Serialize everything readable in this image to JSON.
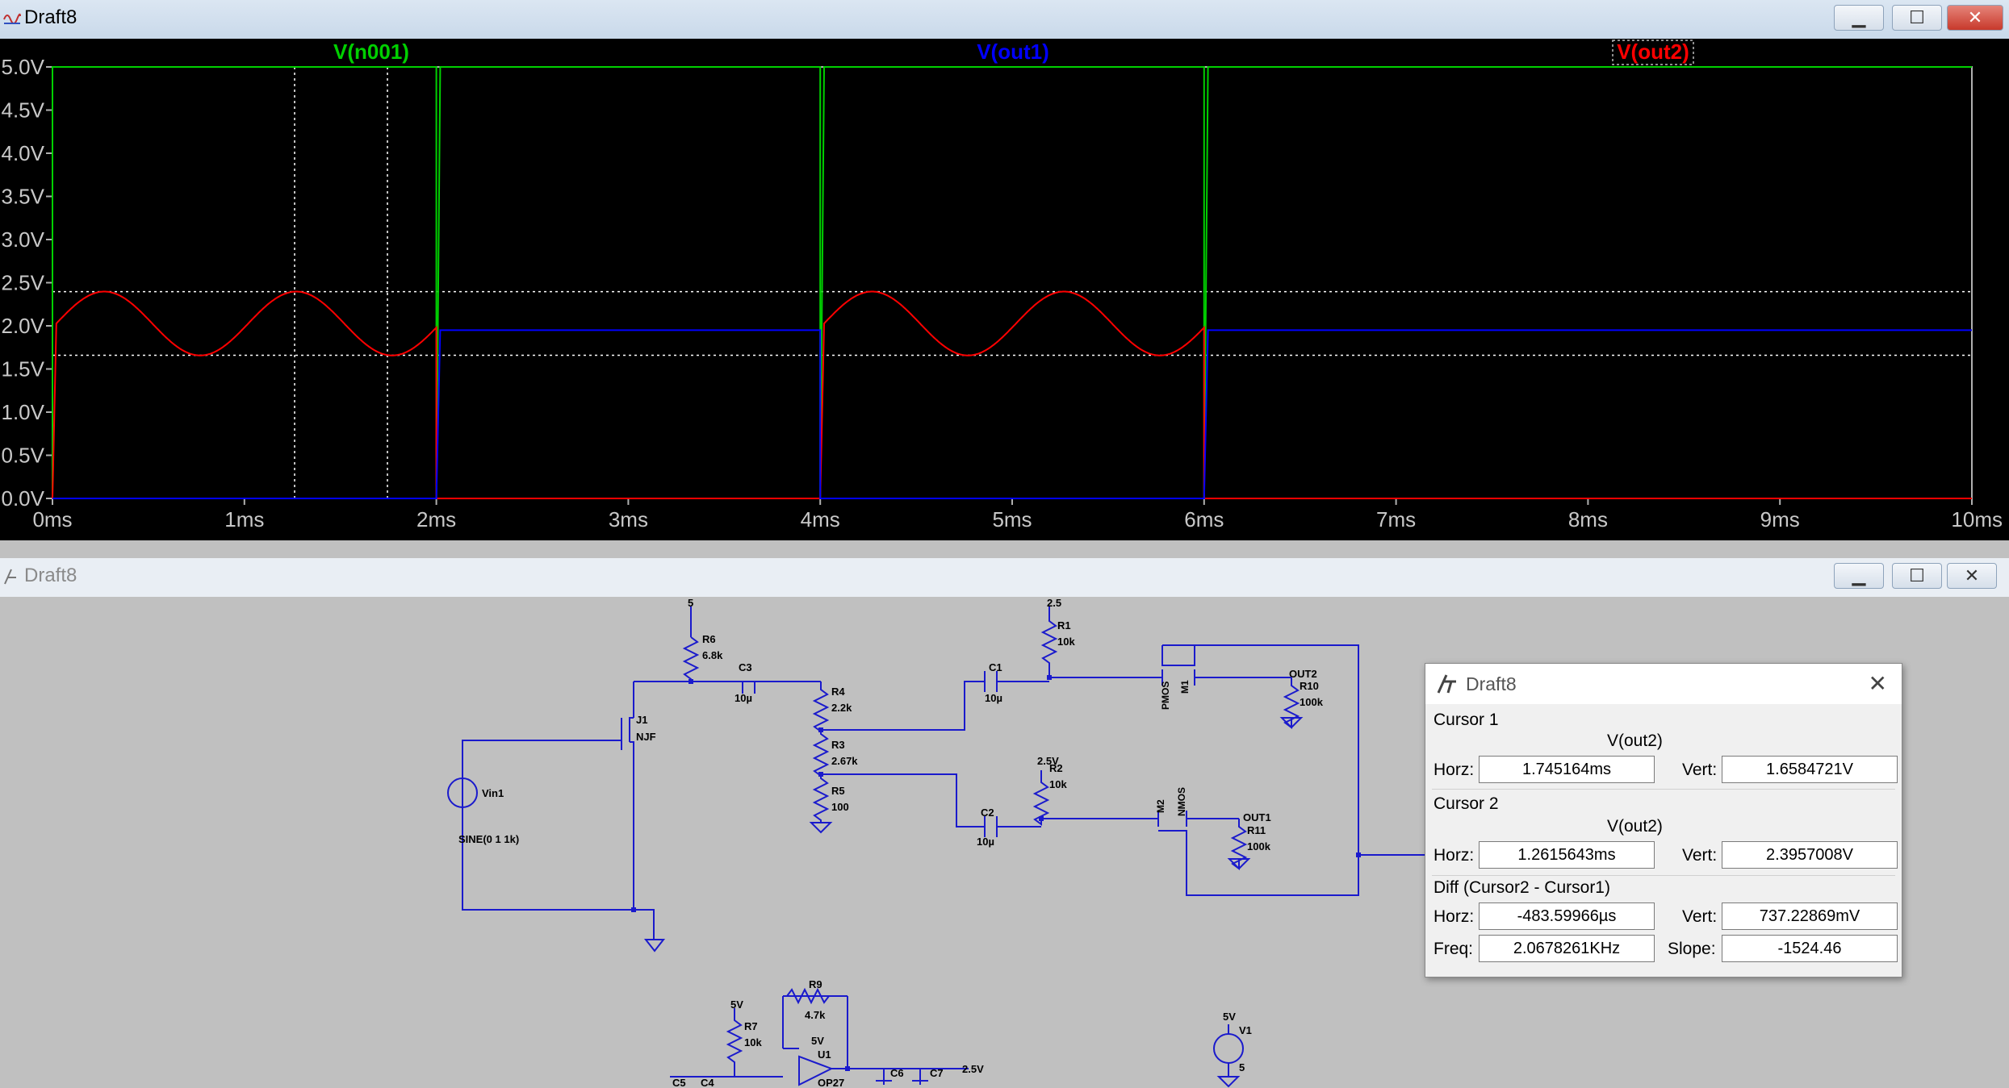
{
  "top_window": {
    "title": "Draft8",
    "minimize": "▁",
    "maximize": "☐",
    "close": "✕"
  },
  "plot": {
    "traces": [
      {
        "name": "V(n001)",
        "color": "#00d000"
      },
      {
        "name": "V(out1)",
        "color": "#0000ff"
      },
      {
        "name": "V(out2)",
        "color": "#ff0000"
      }
    ],
    "y_ticks": [
      "5.0V",
      "4.5V",
      "4.0V",
      "3.5V",
      "3.0V",
      "2.5V",
      "2.0V",
      "1.5V",
      "1.0V",
      "0.5V",
      "0.0V"
    ],
    "x_ticks": [
      "0ms",
      "1ms",
      "2ms",
      "3ms",
      "4ms",
      "5ms",
      "6ms",
      "7ms",
      "8ms",
      "9ms",
      "10ms"
    ]
  },
  "chart_data": {
    "type": "line",
    "xlabel": "",
    "ylabel": "",
    "xlim": [
      0,
      10
    ],
    "ylim": [
      0,
      5
    ],
    "series": [
      {
        "name": "V(n001)",
        "segments": [
          [
            0,
            0
          ],
          [
            0,
            5
          ],
          [
            0.02,
            5
          ],
          [
            2.0,
            5
          ],
          [
            2.0,
            0
          ],
          [
            2.02,
            5
          ],
          [
            4.0,
            5
          ],
          [
            4.0,
            0
          ],
          [
            4.02,
            5
          ],
          [
            6.0,
            5
          ],
          [
            6.0,
            0
          ],
          [
            6.02,
            5
          ],
          [
            10,
            5
          ]
        ]
      },
      {
        "name": "V(out1)",
        "values_note": "",
        "points": [
          [
            0,
            0
          ],
          [
            2.0,
            0
          ],
          [
            2.02,
            1.95
          ],
          [
            4.0,
            1.95
          ],
          [
            4.0,
            0
          ],
          [
            6.0,
            0
          ],
          [
            6.02,
            1.95
          ],
          [
            10,
            1.95
          ]
        ]
      },
      {
        "name": "V(out2)",
        "points": [
          [
            0,
            0
          ],
          [
            0.02,
            1.7
          ],
          [
            0.25,
            2.4
          ],
          [
            0.75,
            1.66
          ],
          [
            1.25,
            2.4
          ],
          [
            1.75,
            1.66
          ],
          [
            2.0,
            2.0
          ],
          [
            2.0,
            0
          ],
          [
            4.0,
            0
          ],
          [
            4.02,
            1.7
          ],
          [
            4.25,
            2.4
          ],
          [
            4.75,
            1.66
          ],
          [
            5.25,
            2.4
          ],
          [
            5.75,
            1.66
          ],
          [
            6.0,
            2.0
          ],
          [
            6.0,
            0
          ],
          [
            10,
            0
          ]
        ]
      }
    ],
    "cursors": {
      "x": [
        1.2615643,
        1.745164
      ],
      "y": [
        2.3957008,
        1.6584721
      ]
    }
  },
  "schematic_window": {
    "title": "Draft8",
    "minimize": "▁",
    "maximize": "☐",
    "close": "✕",
    "labels": {
      "r6": "R6",
      "r6v": "6.8k",
      "c3": "C3",
      "c3v": "10µ",
      "r4": "R4",
      "r4v": "2.2k",
      "r3": "R3",
      "r3v": "2.67k",
      "r5": "R5",
      "r5v": "100",
      "j1": "J1",
      "njf": "NJF",
      "vin1": "Vin1",
      "sine": "SINE(0 1 1k)",
      "r1": "R1",
      "r1v": "10k",
      "c1": "C1",
      "c1v": "10µ",
      "r2": "R2",
      "r2v": "10k",
      "c2": "C2",
      "c2v": "10µ",
      "pmos": "PMOS",
      "m1": "M1",
      "m2": "M2",
      "nmos": "NMOS",
      "out2": "OUT2",
      "r10": "R10",
      "r10v": "100k",
      "out1": "OUT1",
      "r11": "R11",
      "r11v": "100k",
      "r9": "R9",
      "r9v": "4.7k",
      "r7": "R7",
      "r7v": "10k",
      "u1": "U1",
      "op27": "OP27",
      "c6": "C6",
      "c7": "C7",
      "v25": "2.5V",
      "v1": "V1",
      "v5": "5",
      "c5": "C5",
      "c4": "C4",
      "supply5": "5",
      "supply25a": "2.5",
      "supply25b": "2.5V",
      "supply5v": "5V",
      "supply5v2": "5V",
      "supply5v3": "5V"
    }
  },
  "cursor_dialog": {
    "title": "Draft8",
    "close": "✕",
    "cursor1_label": "Cursor 1",
    "cursor1_trace": "V(out2)",
    "cursor1_horz": "1.745164ms",
    "cursor1_vert": "1.6584721V",
    "cursor2_label": "Cursor 2",
    "cursor2_trace": "V(out2)",
    "cursor2_horz": "1.2615643ms",
    "cursor2_vert": "2.3957008V",
    "diff_label": "Diff (Cursor2 - Cursor1)",
    "diff_horz": "-483.59966µs",
    "diff_vert": "737.22869mV",
    "freq": "2.0678261KHz",
    "slope": "-1524.46",
    "horz_label": "Horz:",
    "vert_label": "Vert:",
    "freq_label": "Freq:",
    "slope_label": "Slope:"
  }
}
